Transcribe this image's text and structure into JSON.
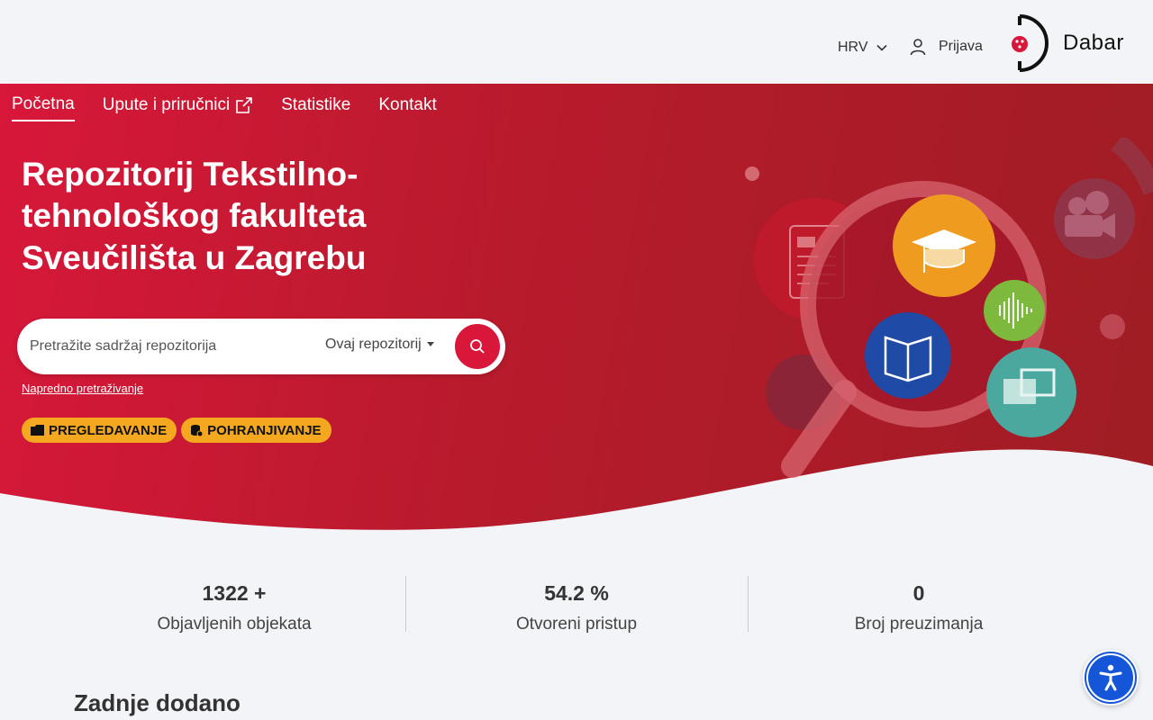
{
  "header": {
    "language": "HRV",
    "login": "Prijava",
    "logo_text": "Dabar"
  },
  "nav": {
    "items": [
      {
        "label": "Početna",
        "active": true
      },
      {
        "label": "Upute i priručnici",
        "external": true
      },
      {
        "label": "Statistike"
      },
      {
        "label": "Kontakt"
      }
    ]
  },
  "hero": {
    "title": "Repozitorij Tekstilno-tehnološkog fakulteta Sveučilišta u Zagrebu",
    "search": {
      "placeholder": "Pretražite sadržaj repozitorija",
      "scope": "Ovaj repozitorij"
    },
    "advanced_search": "Napredno pretraživanje",
    "chips": [
      "PREGLEDAVANJE",
      "POHRANJIVANJE"
    ]
  },
  "stats": [
    {
      "value": "1322 +",
      "label": "Objavljenih objekata"
    },
    {
      "value": "54.2 %",
      "label": "Otvoreni pristup"
    },
    {
      "value": "0",
      "label": "Broj preuzimanja"
    }
  ],
  "recent": {
    "heading": "Zadnje dodano"
  },
  "colors": {
    "brand_red": "#d8173a",
    "chip_yellow": "#f3a81f",
    "a11y_blue": "#1556d8"
  },
  "icons": {
    "language_dropdown": "chevron-down-icon",
    "login": "user-icon",
    "search": "search-icon",
    "external": "external-link-icon",
    "accessibility": "accessibility-icon"
  }
}
